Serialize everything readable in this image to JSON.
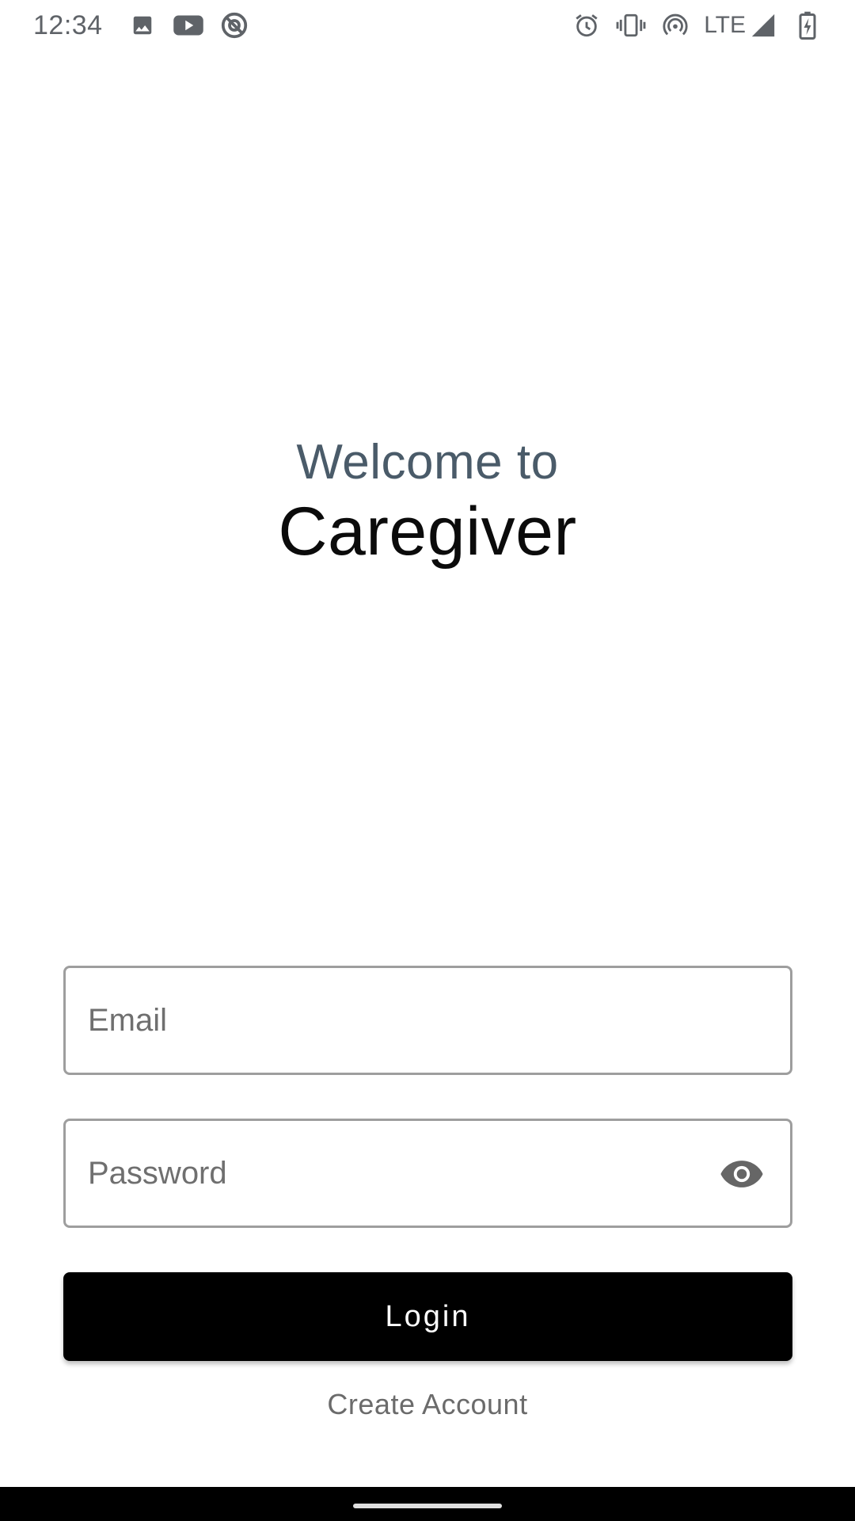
{
  "status_bar": {
    "time": "12:34",
    "left_icons": [
      "image-icon",
      "youtube-icon",
      "no-disturb-icon"
    ],
    "right_icons": [
      "alarm-icon",
      "vibrate-icon",
      "hotspot-icon",
      "signal-icon",
      "battery-charging-icon"
    ],
    "network_label": "LTE"
  },
  "welcome": {
    "line1": "Welcome to",
    "app_name": "Caregiver"
  },
  "form": {
    "email": {
      "value": "",
      "placeholder": "Email"
    },
    "password": {
      "value": "",
      "placeholder": "Password",
      "toggle_icon": "eye-icon"
    },
    "login_label": "Login",
    "create_account_label": "Create Account"
  },
  "colors": {
    "welcome_text": "#4a5b69",
    "title_text": "#0b0b0b",
    "button_bg": "#000000",
    "button_text": "#ffffff",
    "field_border": "#9e9e9e",
    "link_text": "#6b6b6b"
  }
}
